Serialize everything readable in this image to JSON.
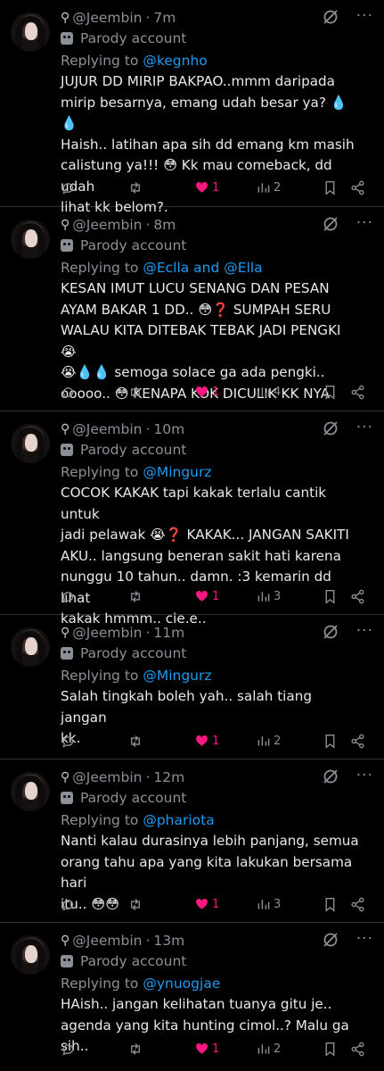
{
  "tweets": [
    {
      "handle": "@Jeembin",
      "time": "7m",
      "parody": "Parody account",
      "replying_prefix": "Replying to",
      "replying_to": "@kegnho",
      "text": "JUJUR DD MIRIP BAKPAO..mmm daripada\nmirip besarnya, emang udah besar ya? 💧💧\nHaish.. latihan apa sih dd emang km masih\ncalistung ya!!! 😳 Kk mau comeback, dd udah\nlihat kk belom?.",
      "likes": "1",
      "views": "2"
    },
    {
      "handle": "@Jeembin",
      "time": "8m",
      "parody": "Parody account",
      "replying_prefix": "Replying to",
      "replying_to": "@Eclla and @Ella",
      "text": "KESAN IMUT LUCU SENANG DAN PESAN\nAYAM BAKAR 1 DD.. 😳❓ SUMPAH SERU\nWALAU KITA DITEBAK TEBAK JADI PENGKI 😭\n😭💧💧 semoga solace ga ada pengki..\nooooo.. 😳 KENAPA KOK DICULIK KK NYA",
      "likes": "1",
      "views": "4"
    },
    {
      "handle": "@Jeembin",
      "time": "10m",
      "parody": "Parody account",
      "replying_prefix": "Replying to",
      "replying_to": "@Mingurz",
      "text": "COCOK KAKAK tapi kakak terlalu cantik untuk\njadi pelawak 😭❓ KAKAK... JANGAN SAKITI\nAKU.. langsung beneran sakit hati karena\nnunggu 10 tahun.. damn. :3 kemarin dd lihat\nkakak hmmm.. cie.e..",
      "likes": "1",
      "views": "3"
    },
    {
      "handle": "@Jeembin",
      "time": "11m",
      "parody": "Parody account",
      "replying_prefix": "Replying to",
      "replying_to": "@Mingurz",
      "text": "Salah tingkah boleh yah.. salah tiang jangan\nkk.",
      "likes": "1",
      "views": "2"
    },
    {
      "handle": "@Jeembin",
      "time": "12m",
      "parody": "Parody account",
      "replying_prefix": "Replying to",
      "replying_to": "@phariota",
      "text": "Nanti kalau durasinya lebih panjang, semua\norang tahu apa yang kita lakukan bersama hari\nitu.. 😳😳",
      "likes": "1",
      "views": "3"
    },
    {
      "handle": "@Jeembin",
      "time": "13m",
      "parody": "Parody account",
      "replying_prefix": "Replying to",
      "replying_to": "@ynuogjae",
      "text": "HAish.. jangan kelihatan tuanya gitu je..\nagenda yang kita hunting cimol..? Malu ga sih..",
      "likes": "1",
      "views": "2"
    }
  ]
}
